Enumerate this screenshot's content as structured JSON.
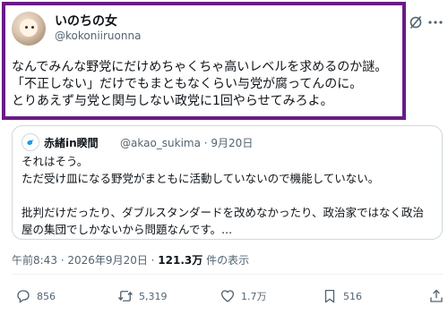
{
  "tweet": {
    "display_name": "いのちの女",
    "handle": "@kokoniiruonna",
    "text_lines": [
      "なんでみんな野党にだけめちゃくちゃ高いレベルを求めるのか謎。",
      "「不正しない」だけでもまともなくらい与党が腐ってんのに。",
      "とりあえず与党と関与しない政党に1回やらせてみろよ。"
    ],
    "timestamp": "午前8:43 · 2026年9月20日 ·",
    "views_count": "121.3万",
    "views_label": "件の表示"
  },
  "quote": {
    "display_name": "赤緒in睽間",
    "handle_date": "@akao_sukima · 9月20日",
    "text_lines": [
      "それはそう。",
      "ただ受け皿になる野党がまともに活動していないので機能していない。"
    ],
    "text_lines_2": [
      "批判だけだったり、ダブルスタンダードを改めなかったり、政治家ではなく政治",
      "屋の集団でしかないから問題なんです。..."
    ]
  },
  "actions": {
    "reply_count": "856",
    "retweet_count": "5,319",
    "like_count": "1.7万",
    "bookmark_count": "516"
  },
  "colors": {
    "highlight_border": "#6a1b86",
    "secondary_text": "#536471",
    "primary_text": "#0f1419"
  },
  "icons": [
    "grok-icon",
    "more-icon",
    "reply-icon",
    "retweet-icon",
    "like-icon",
    "bookmark-icon",
    "share-icon"
  ]
}
